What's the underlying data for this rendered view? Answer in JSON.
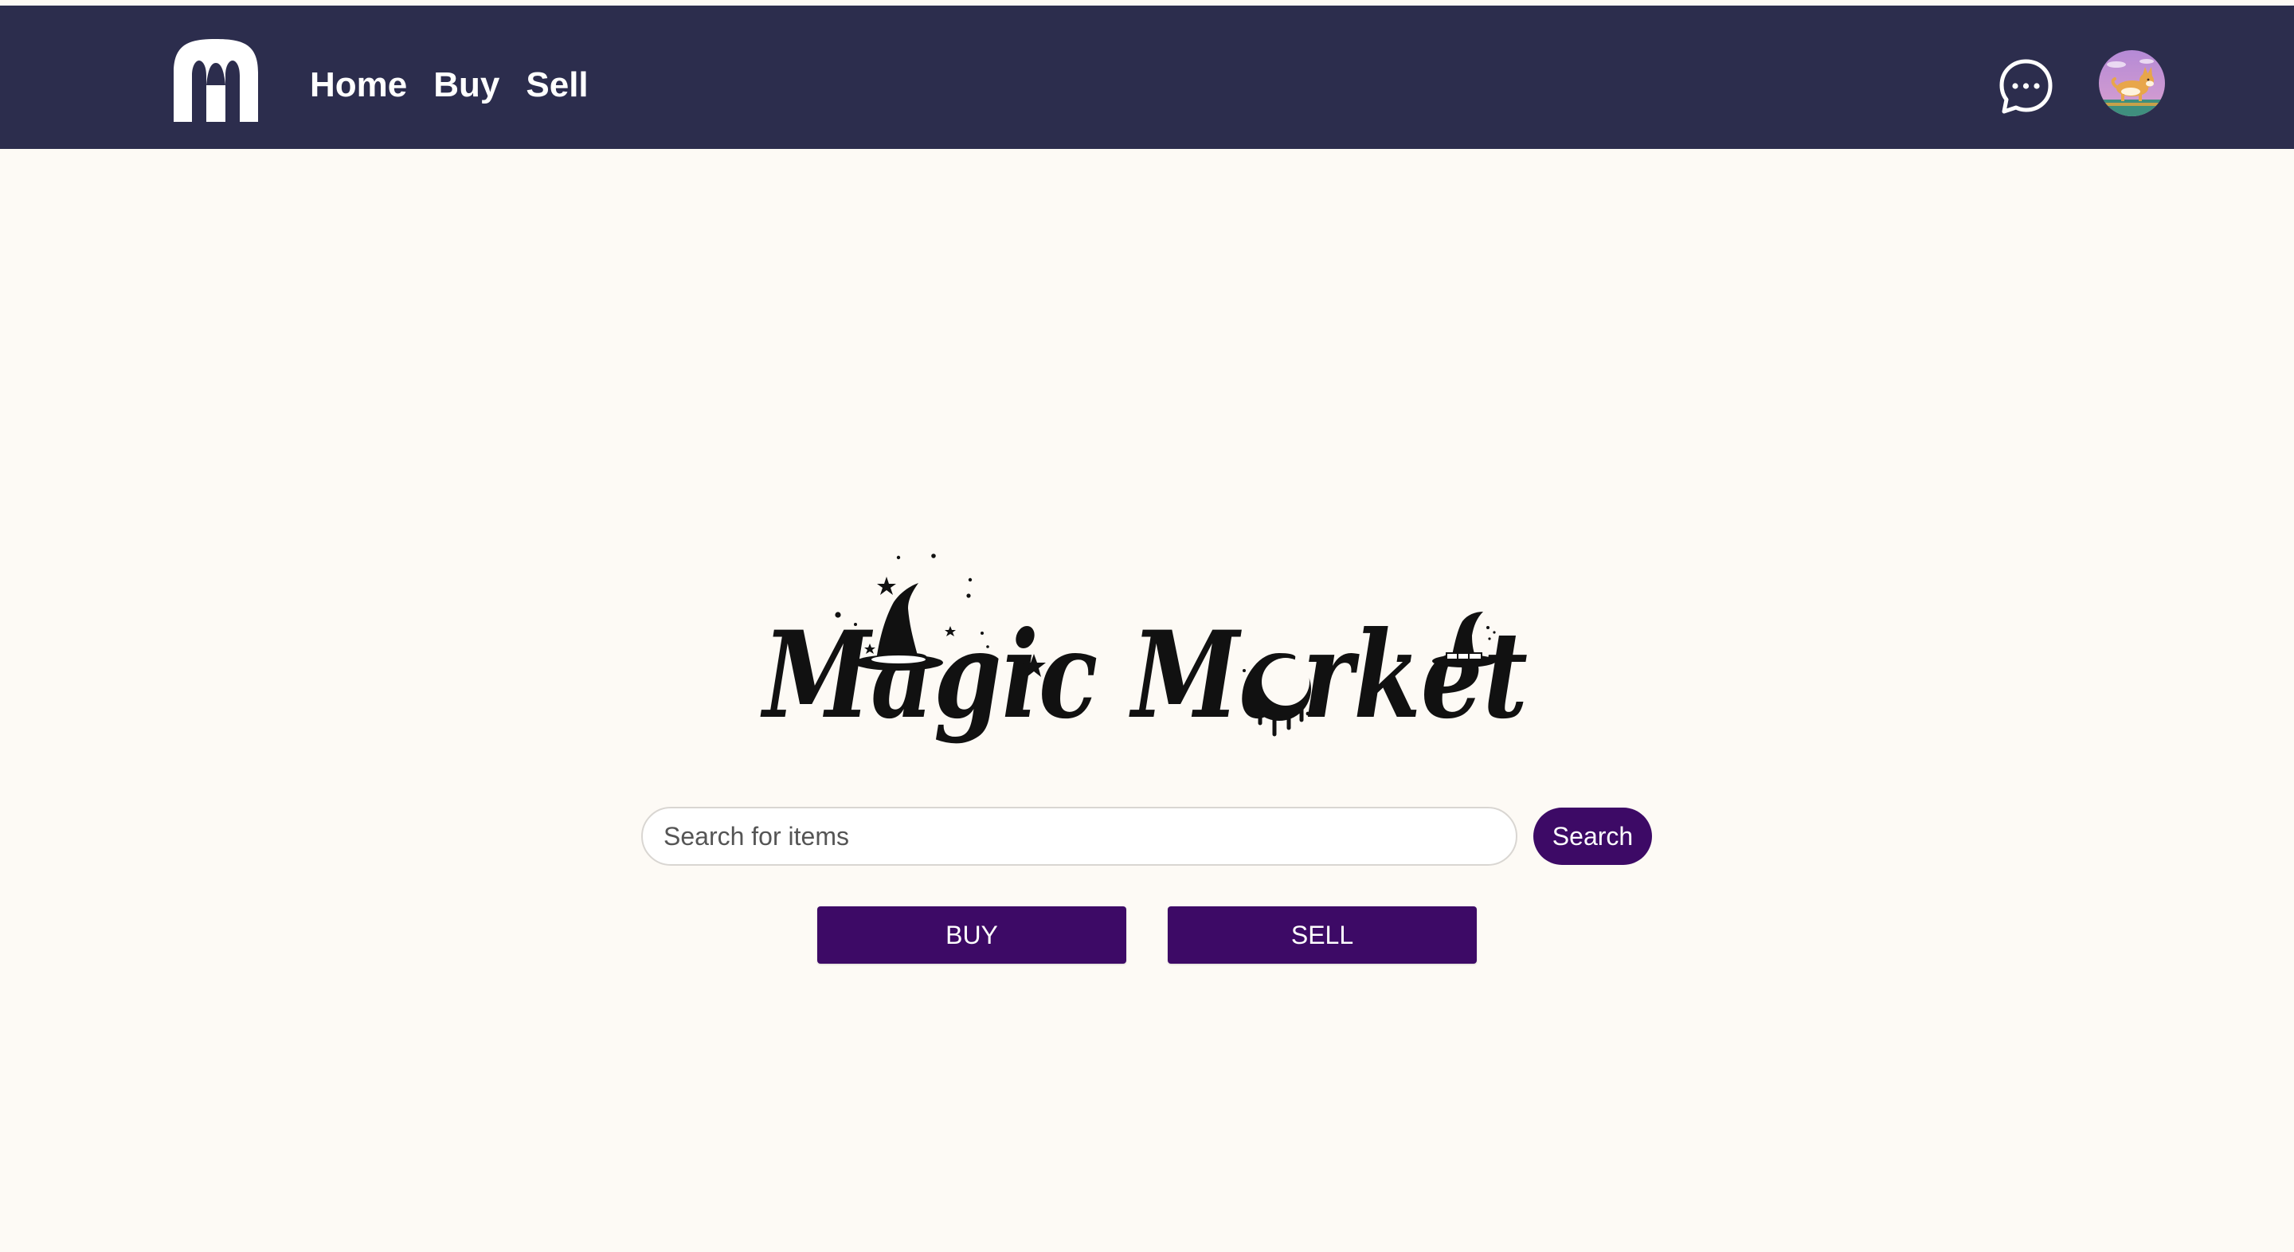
{
  "brand": {
    "logo_icon": "m-letter-logo-icon",
    "wordmark": "Magic Market"
  },
  "nav": {
    "items": [
      {
        "label": "Home"
      },
      {
        "label": "Buy"
      },
      {
        "label": "Sell"
      }
    ]
  },
  "header": {
    "chat_icon": "chat-bubble-icon",
    "avatar_icon": "corgi-avatar"
  },
  "search": {
    "placeholder": "Search for items",
    "value": "",
    "button_label": "Search"
  },
  "actions": {
    "buy_label": "BUY",
    "sell_label": "SELL"
  },
  "colors": {
    "navbar_bg": "#2c2d4d",
    "page_bg": "#fdfaf5",
    "accent": "#3d0a66"
  }
}
